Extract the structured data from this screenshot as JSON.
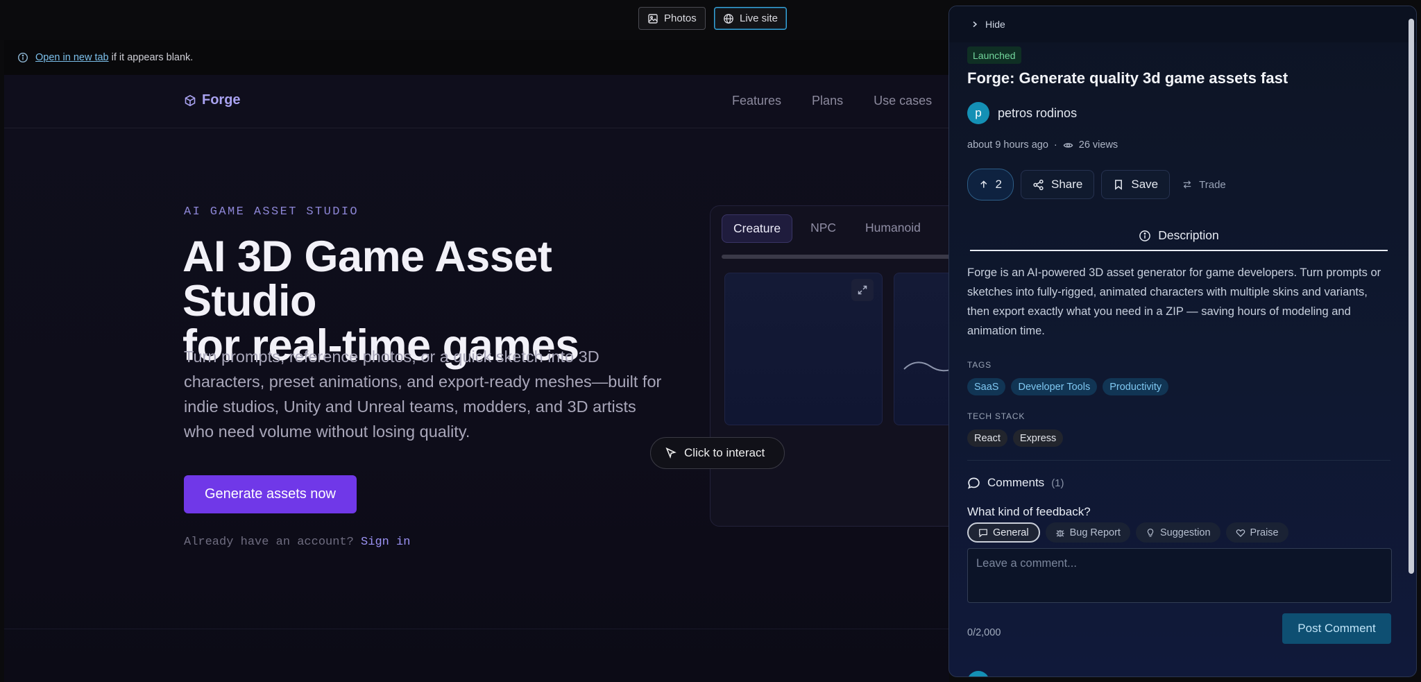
{
  "topbar": {
    "photos_label": "Photos",
    "live_site_label": "Live site"
  },
  "notice": {
    "link_text": "Open in new tab",
    "rest_text": "if it appears blank."
  },
  "site": {
    "logo": "Forge",
    "nav": [
      "Features",
      "Plans",
      "Use cases"
    ],
    "eyebrow": "AI GAME ASSET STUDIO",
    "title_line1": "AI 3D Game Asset Studio",
    "title_line2": "for real-time games",
    "subtitle": "Turn prompts, reference photos, or a quick sketch into 3D characters, preset animations, and export-ready meshes—built for indie studios, Unity and Unreal teams, modders, and 3D artists who need volume without losing quality.",
    "cta": "Generate assets now",
    "signin_prompt": "Already have an account?",
    "signin_link": "Sign in",
    "viewer_tabs": [
      "Creature",
      "NPC",
      "Humanoid"
    ],
    "viewer_active_tab": "Creature",
    "interact_label": "Click to interact"
  },
  "panel": {
    "hide_label": "Hide",
    "status_badge": "Launched",
    "title": "Forge: Generate quality 3d game assets fast",
    "author_initial": "p",
    "author_name": "petros rodinos",
    "posted": "about 9 hours ago",
    "separator": "·",
    "views": "26 views",
    "upvotes": "2",
    "share_label": "Share",
    "save_label": "Save",
    "trade_label": "Trade",
    "description_tab": "Description",
    "description": "Forge is an AI-powered 3D asset generator for game developers. Turn prompts or sketches into fully-rigged, animated characters with multiple skins and variants, then export exactly what you need in a ZIP — saving hours of modeling and animation time.",
    "tags_label": "TAGS",
    "tags": [
      "SaaS",
      "Developer Tools",
      "Productivity"
    ],
    "tech_label": "TECH STACK",
    "tech": [
      "React",
      "Express"
    ],
    "comments_label": "Comments",
    "comments_count": "(1)",
    "feedback_question": "What kind of feedback?",
    "feedback_types": [
      "General",
      "Bug Report",
      "Suggestion",
      "Praise"
    ],
    "feedback_selected": "General",
    "comment_placeholder": "Leave a comment...",
    "char_counter": "0/2,000",
    "post_label": "Post Comment"
  },
  "colors": {
    "accent_purple": "#7038e8",
    "accent_blue": "#3aa3d8",
    "launched_green": "#73d79d",
    "tag_blue": "#7fc8f2"
  }
}
